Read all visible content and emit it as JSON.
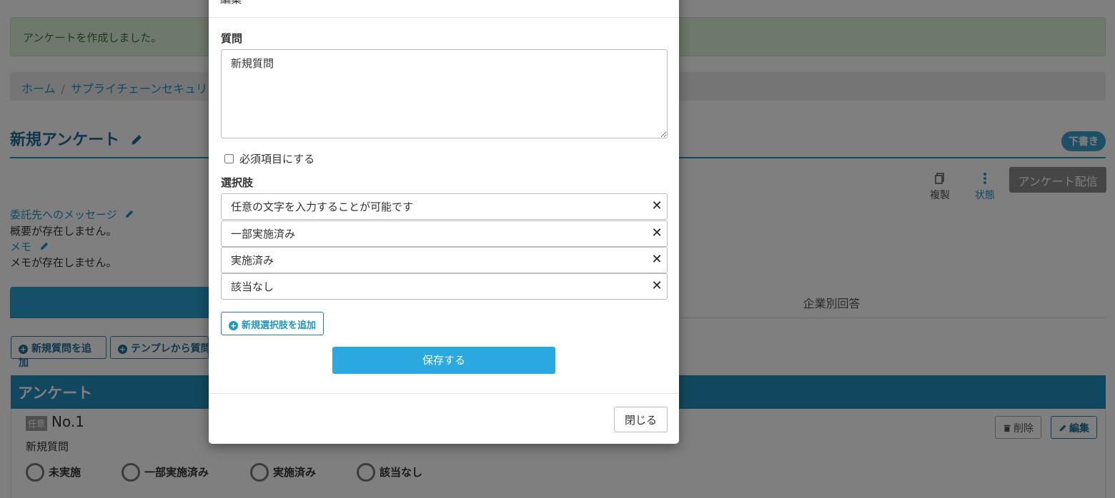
{
  "alert": {
    "message": "アンケートを作成しました。"
  },
  "breadcrumb": {
    "home": "ホーム",
    "current": "サプライチェーンセキュリ"
  },
  "header": {
    "title": "新規アンケート",
    "status_badge": "下書き"
  },
  "toolbar": {
    "copy_label": "複製",
    "status_label": "状態",
    "publish_label": "アンケート配信"
  },
  "meta": {
    "message_label": "委託先へのメッセージ",
    "message_text": "概要が存在しません。",
    "memo_label": "メモ",
    "memo_text": "メモが存在しません。"
  },
  "tabs": {
    "company_answers": "企業別回答"
  },
  "actions": {
    "add_question": "新規質問を追加",
    "add_from_template": "テンプレから質問"
  },
  "survey": {
    "section_title": "アンケート",
    "question": {
      "optional_badge": "任意",
      "number": "No.1",
      "text": "新規質問",
      "options": [
        "未実施",
        "一部実施済み",
        "実施済み",
        "該当なし"
      ],
      "delete_label": "削除",
      "edit_label": "編集"
    }
  },
  "modal": {
    "title": "編集",
    "question_label": "質問",
    "question_value": "新規質問",
    "required_label": "必須項目にする",
    "choices_label": "選択肢",
    "choices": [
      "任意の文字を入力することが可能です",
      "一部実施済み",
      "実施済み",
      "該当なし"
    ],
    "add_choice_label": "新規選択肢を追加",
    "save_label": "保存する",
    "close_label": "閉じる"
  },
  "colors": {
    "accent": "#2aa8e0",
    "header_blue": "#2490be",
    "title_blue": "#1e6f97"
  }
}
